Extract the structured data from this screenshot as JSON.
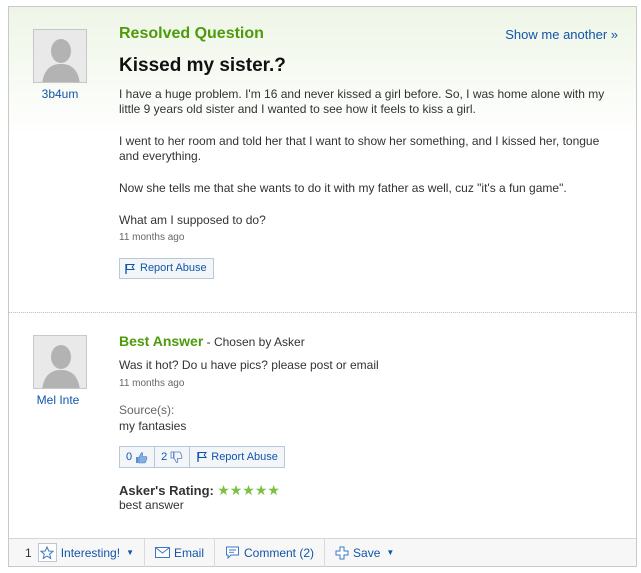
{
  "question": {
    "status_label": "Resolved Question",
    "show_another": "Show me another »",
    "asker_name": "3b4um",
    "title": "Kissed my sister.?",
    "paragraphs": [
      "I have a huge problem. I'm 16 and never kissed a girl before. So, I was home alone with my little 9 years old sister and I wanted to see how it feels to kiss a girl.",
      "I went to her room and told her that I want to show her something, and I kissed her, tongue and everything.",
      "Now she tells me that she wants to do it with my father as well, cuz \"it's a fun game\".",
      "What am I supposed to do?"
    ],
    "time": "11 months ago",
    "report_label": "Report Abuse"
  },
  "answer": {
    "best_label": "Best Answer",
    "chosen": "- Chosen by Asker",
    "answerer_name": "Mel Inte",
    "text": "Was it hot? Do u have pics? please post or email",
    "time": "11 months ago",
    "sources_label": "Source(s):",
    "sources_value": "my fantasies",
    "thumbs_up_count": "0",
    "thumbs_down_count": "2",
    "report_label": "Report Abuse",
    "rating_label": "Asker's Rating:",
    "rating_stars": "*****",
    "rating_comment": "best answer"
  },
  "toolbar": {
    "interesting_count": "1",
    "interesting_label": "Interesting!",
    "email_label": "Email",
    "comment_label": "Comment (2)",
    "save_label": "Save"
  },
  "colors": {
    "accent_green": "#4d9b0b",
    "link_blue": "#1155aa",
    "star_green": "#7ac142"
  }
}
